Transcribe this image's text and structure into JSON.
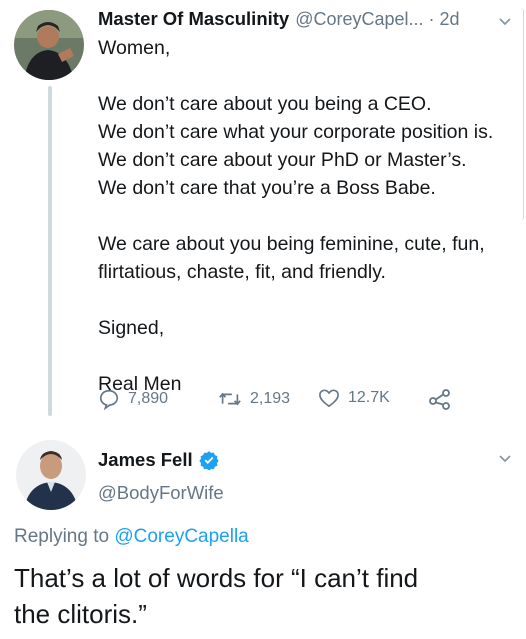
{
  "tweet1": {
    "display_name": "Master Of Masculinity",
    "handle_time": "@CoreyCapel... · 2d",
    "lines": [
      "Women,",
      "",
      "We don’t care about you being a CEO.",
      "We don’t care what your corporate position is.",
      "We don’t care about your PhD or Master’s.",
      "We don’t care that you’re a Boss Babe.",
      "",
      "We care about you being feminine, cute, fun,",
      "flirtatious, chaste, fit, and friendly.",
      "",
      "Signed,",
      "",
      "Real Men"
    ],
    "replies": "7,890",
    "retweets": "2,193",
    "likes": "12.7K"
  },
  "tweet2": {
    "display_name": "James Fell",
    "handle": "@BodyForWife",
    "replying_to_prefix": "Replying to ",
    "replying_to_handle": "@CoreyCapella",
    "text_line1": "That’s a lot of words for “I can’t find",
    "text_line2": "the clitoris.”"
  },
  "colors": {
    "link_blue": "#1da1f2",
    "muted": "#657786",
    "verified": "#1da1f2"
  }
}
